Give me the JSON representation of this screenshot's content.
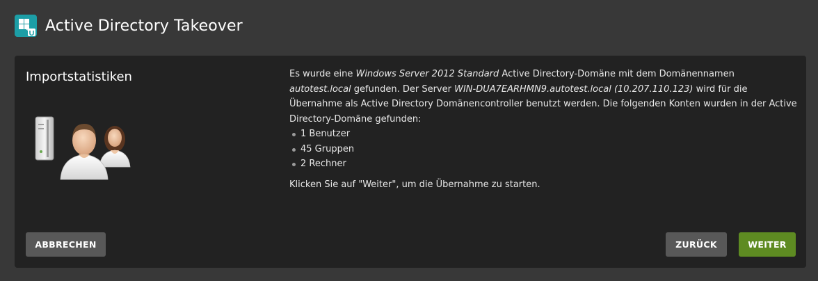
{
  "header": {
    "title": "Active Directory Takeover",
    "icon": "active-directory-app-icon"
  },
  "section": {
    "title": "Importstatistiken",
    "illustration": "server-and-users-illustration"
  },
  "message": {
    "p1_part1": "Es wurde eine ",
    "os_name": "Windows Server 2012 Standard",
    "p1_part2": " Active Directory-Domäne mit dem Domänennamen ",
    "domain_name": "autotest.local",
    "p1_part3": " gefunden. Der Server ",
    "server_name": "WIN-DUA7EARHMN9.autotest.local (10.207.110.123)",
    "p1_part4": " wird für die Übernahme als Active Directory Domänencontroller benutzt werden. Die folgenden Konten wurden in der Active Directory-Domäne gefunden:",
    "stats": [
      "1 Benutzer",
      "45 Gruppen",
      "2 Rechner"
    ],
    "hint": "Klicken Sie auf \"Weiter\", um die Übernahme zu starten."
  },
  "buttons": {
    "cancel": "ABBRECHEN",
    "back": "ZURÜCK",
    "next": "WEITER"
  },
  "colors": {
    "background": "#383838",
    "panel": "#222222",
    "accent_teal": "#1c9ea6",
    "primary_green": "#5e8b22",
    "secondary_gray": "#585858"
  }
}
